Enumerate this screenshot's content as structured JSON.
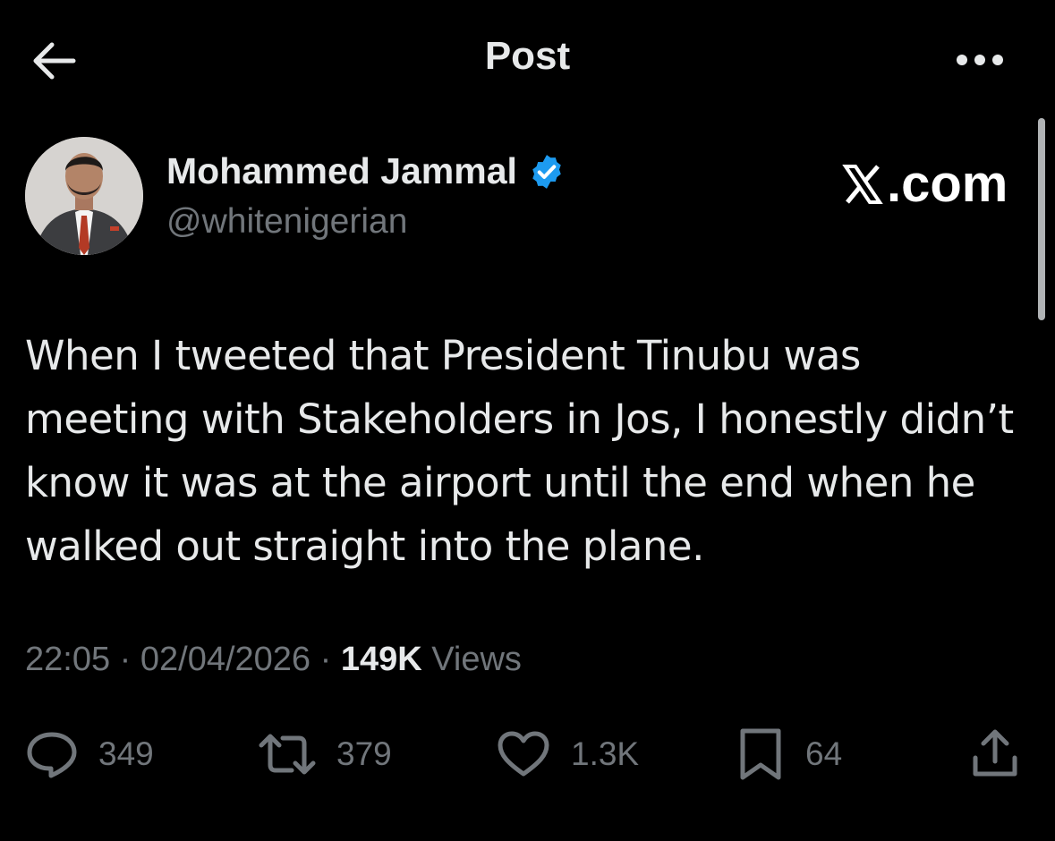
{
  "header": {
    "title": "Post",
    "back_icon": "arrow-left-icon",
    "more_icon": "more-horizontal-icon"
  },
  "author": {
    "name": "Mohammed Jammal",
    "handle": "@whitenigerian",
    "verified": true,
    "verified_color": "#1d9bf0"
  },
  "watermark": {
    "text": ".com",
    "icon": "x-logo-icon"
  },
  "post": {
    "text": "When I tweeted that President Tinubu was meeting with Stakeholders in Jos, I honestly didn’t know it was at the airport until the end when he walked out straight into the plane."
  },
  "meta": {
    "time": "22:05",
    "separator": "·",
    "date": "02/04/2026",
    "views_count": "149K",
    "views_label": "Views"
  },
  "actions": {
    "reply": {
      "icon": "reply-icon",
      "count": "349"
    },
    "repost": {
      "icon": "repost-icon",
      "count": "379"
    },
    "like": {
      "icon": "heart-icon",
      "count": "1.3K"
    },
    "bookmark": {
      "icon": "bookmark-icon",
      "count": "64"
    },
    "share": {
      "icon": "share-icon"
    }
  },
  "colors": {
    "background": "#000000",
    "primary_text": "#e7e9ea",
    "secondary_text": "#71767b",
    "accent": "#1d9bf0"
  }
}
